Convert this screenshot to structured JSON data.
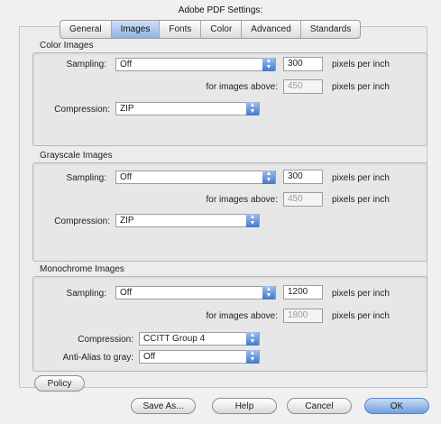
{
  "window": {
    "title": "Adobe PDF Settings:"
  },
  "tabs": [
    "General",
    "Images",
    "Fonts",
    "Color",
    "Advanced",
    "Standards"
  ],
  "active_tab": "Images",
  "color": {
    "heading": "Color Images",
    "sampling_label": "Sampling:",
    "sampling_value": "Off",
    "ppi_value": "300",
    "ppi_unit": "pixels per inch",
    "above_label": "for images above:",
    "above_value": "450",
    "above_unit": "pixels per inch",
    "compression_label": "Compression:",
    "compression_value": "ZIP"
  },
  "grayscale": {
    "heading": "Grayscale Images",
    "sampling_label": "Sampling:",
    "sampling_value": "Off",
    "ppi_value": "300",
    "ppi_unit": "pixels per inch",
    "above_label": "for images above:",
    "above_value": "450",
    "above_unit": "pixels per inch",
    "compression_label": "Compression:",
    "compression_value": "ZIP"
  },
  "monochrome": {
    "heading": "Monochrome Images",
    "sampling_label": "Sampling:",
    "sampling_value": "Off",
    "ppi_value": "1200",
    "ppi_unit": "pixels per inch",
    "above_label": "for images above:",
    "above_value": "1800",
    "above_unit": "pixels per inch",
    "compression_label": "Compression:",
    "compression_value": "CCITT Group 4",
    "antialias_label": "Anti-Alias to gray:",
    "antialias_value": "Off"
  },
  "buttons": {
    "policy": "Policy",
    "save_as": "Save As...",
    "help": "Help",
    "cancel": "Cancel",
    "ok": "OK"
  }
}
